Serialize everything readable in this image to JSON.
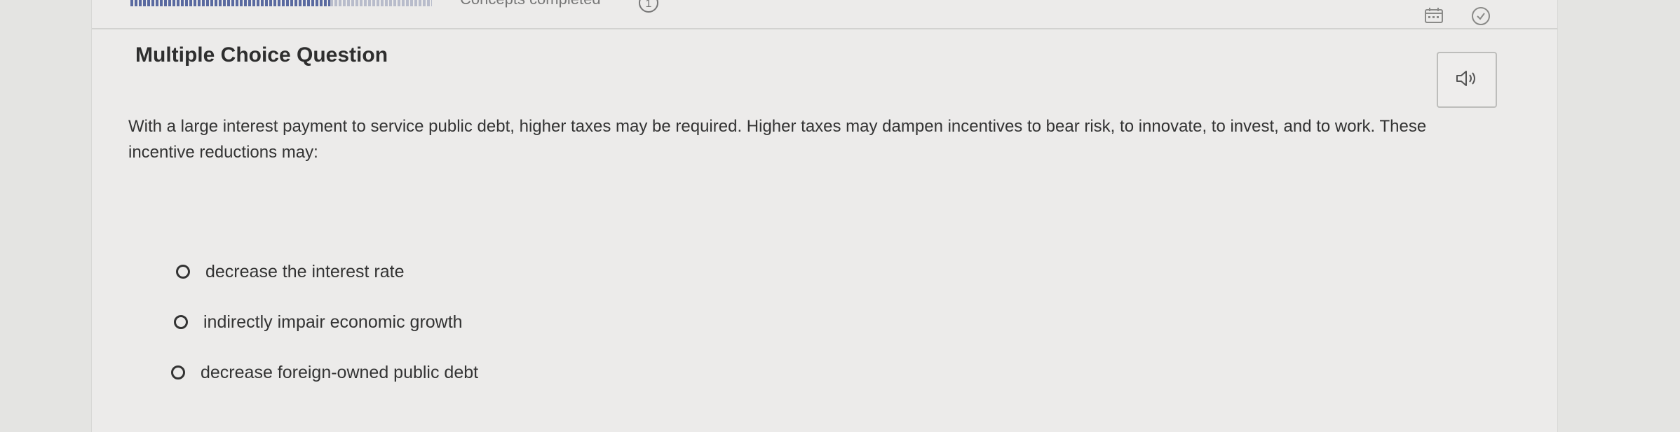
{
  "header": {
    "concepts_label": "Concepts completed",
    "concepts_count": "1"
  },
  "question": {
    "type_label": "Multiple Choice Question",
    "prompt": "With a large interest payment to service public debt, higher taxes may be required. Higher taxes may dampen incentives to bear risk, to innovate, to invest, and to work. These incentive reductions may:",
    "options": [
      {
        "label": "decrease the interest rate"
      },
      {
        "label": "indirectly impair economic growth"
      },
      {
        "label": "decrease foreign-owned public debt"
      }
    ]
  },
  "icons": {
    "calendar": "calendar-icon",
    "check": "check-circle-icon",
    "speaker": "speaker-icon"
  },
  "colors": {
    "progress_filled": "#5a6aa0",
    "background": "#ecebea"
  }
}
